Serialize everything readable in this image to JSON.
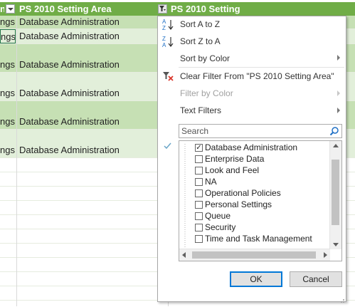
{
  "columns": {
    "col1_partial": "ngs",
    "col2": "PS 2010 Setting Area",
    "col3": "PS 2010 Setting"
  },
  "rows": [
    {
      "c1": "ngs",
      "c2": "Database Administration"
    },
    {
      "c1": "ngs",
      "c2": "Database Administration"
    },
    {
      "c1": "ngs",
      "c2": "Database Administration"
    },
    {
      "c1": "ngs",
      "c2": "Database Administration"
    },
    {
      "c1": "ngs",
      "c2": "Database Administration"
    },
    {
      "c1": "ngs",
      "c2": "Database Administration"
    }
  ],
  "menu": {
    "sort_az": "Sort A to Z",
    "sort_za": "Sort Z to A",
    "sort_by_color": "Sort by Color",
    "clear_filter": "Clear Filter From \"PS 2010 Setting Area\"",
    "filter_by_color": "Filter by Color",
    "text_filters": "Text Filters",
    "search_placeholder": "Search",
    "items": [
      {
        "label": "Database Administration",
        "checked": true
      },
      {
        "label": "Enterprise Data",
        "checked": false
      },
      {
        "label": "Look and Feel",
        "checked": false
      },
      {
        "label": "NA",
        "checked": false
      },
      {
        "label": "Operational Policies",
        "checked": false
      },
      {
        "label": "Personal Settings",
        "checked": false
      },
      {
        "label": "Queue",
        "checked": false
      },
      {
        "label": "Security",
        "checked": false
      },
      {
        "label": "Time and Task Management",
        "checked": false
      }
    ],
    "ok": "OK",
    "cancel": "Cancel"
  },
  "colors": {
    "header_bg": "#70ad47",
    "band_dark": "#c6e0b4",
    "band_light": "#e2efda",
    "accent": "#0078d7"
  }
}
